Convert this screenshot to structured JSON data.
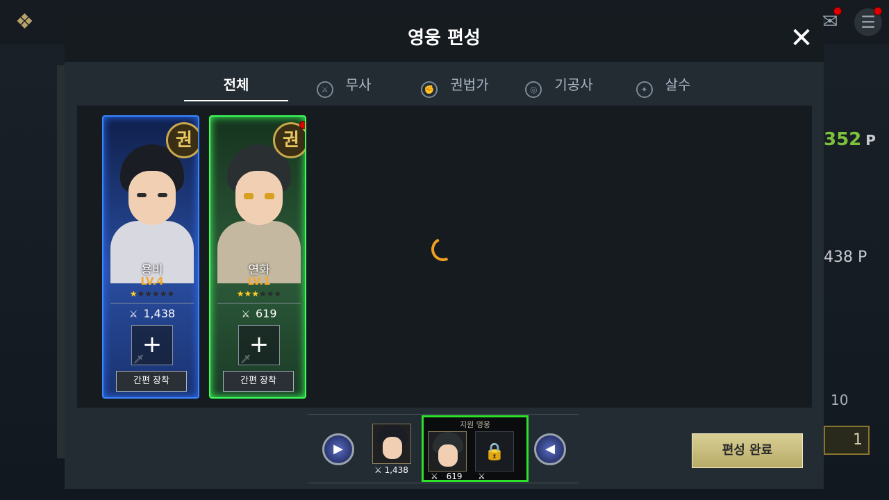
{
  "modal": {
    "title": "영웅 편성",
    "close_symbol": "✕"
  },
  "tabs": [
    {
      "label": "전체",
      "icon": "",
      "active": true
    },
    {
      "label": "무사",
      "icon": "sword-class-icon",
      "active": false
    },
    {
      "label": "권법가",
      "icon": "fist-class-icon",
      "active": false
    },
    {
      "label": "기공사",
      "icon": "qi-class-icon",
      "active": false
    },
    {
      "label": "살수",
      "icon": "assassin-class-icon",
      "active": false
    }
  ],
  "heroes": [
    {
      "name": "용비",
      "level": "LV.4",
      "stars_filled": 1,
      "stars_total": 6,
      "power": "1,438",
      "class_glyph": "권",
      "quick_equip": "간편 장착",
      "frame_color": "#3a86ff"
    },
    {
      "name": "연화",
      "level": "LV.1",
      "stars_filled": 3,
      "stars_total": 6,
      "power": "619",
      "class_glyph": "권",
      "quick_equip": "간편 장착",
      "frame_color": "#3cff5a",
      "has_notification": true
    }
  ],
  "deck": {
    "slot1_power": "1,438",
    "support_label": "지원 영웅",
    "slot2_power": "619"
  },
  "done_button": "편성 완료",
  "background": {
    "power_top": "352",
    "power_unit": "P",
    "power_mid": "438",
    "count": "10",
    "badge": "1"
  }
}
